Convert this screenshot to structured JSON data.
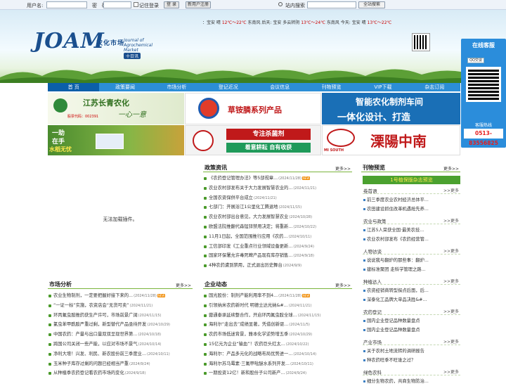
{
  "login": {
    "user_label": "用户名:",
    "pass_label": "密　码:",
    "remember_label": "记住登录",
    "login_button": "登 录",
    "register_button": "新用户注册",
    "search_label": "站内搜索",
    "search_button": "全站搜索"
  },
  "weather": {
    "prefix": "：宝安 晴",
    "t1": "12℃～22℃",
    "seg1": "东南风 后天: 宝安 多云转阴",
    "t2": "13℃～24℃",
    "seg2": "东南风 今天: 宝安 晴",
    "t3": "13℃～22℃"
  },
  "brand": {
    "logo": "JOAM",
    "name_cn": "农化市场",
    "name_en": "Journal of Agrochemical Market",
    "tag": "十日讯"
  },
  "nav": [
    "首 页",
    "政策要闻",
    "市场分析",
    "登记近况",
    "会议信息",
    "刊物预览",
    "VIP下载",
    "杂志订阅"
  ],
  "banners": {
    "b1_title": "江苏长青农化",
    "b1_sub": "股票代码：002391",
    "b1_slogan": "一心一意",
    "b2_text": "草铵膦系列产品",
    "b3_line1": "智能农化制剂车间",
    "b3_line2": "一体化设计、打造",
    "b4_line1": "一助",
    "b4_line2": "在手",
    "b4_line3": "水稻无忧",
    "b5_line1": "专注杀菌剂",
    "b5_line2": "着意耕耘 自有收获",
    "b6_brand": "MI SOUTH",
    "b6_text": "溧陽中南"
  },
  "noplug": "无法加载插件。",
  "policy": {
    "title": "政策资讯",
    "more": "更多>>",
    "items": [
      {
        "t": "《农药登记管理办法》等5部规章...",
        "d": "(2024/11/28)",
        "new": true
      },
      {
        "t": "农业农村部发布关于大力发展智慧农业的...",
        "d": "(2024/11/21)",
        "new": false
      },
      {
        "t": "全国农资保供平台成立",
        "d": "(2024/11/21)",
        "new": false
      },
      {
        "t": "七部门：开展浴江1公里化工腾退地",
        "d": "(2024/11/15)",
        "new": false
      },
      {
        "t": "农业农村部出台意见，大力发展智慧农业",
        "d": "(2024/10/28)",
        "new": false
      },
      {
        "t": "欧盟法院推翻代森锰锌禁用决定；将重新...",
        "d": "(2024/10/22)",
        "new": false
      },
      {
        "t": "11月1日起，全国范围推行应用《农药...",
        "d": "(2024/10/11)",
        "new": false
      },
      {
        "t": "工信部印发《工业重点行业领域设备更新...",
        "d": "(2024/9/24)",
        "new": false
      },
      {
        "t": "国家环保署允许毒死蜱产品现有库存销售...",
        "d": "(2024/9/18)",
        "new": false
      },
      {
        "t": "4种农药遭到禁用，正式退出历史舞台",
        "d": "(2024/9/9)",
        "new": false
      }
    ]
  },
  "market": {
    "title": "市场分析",
    "more": "更多>>",
    "items": [
      {
        "t": "农业生物制剂，一定要把握好接下来的...",
        "d": "(2024/11/28)",
        "new": true
      },
      {
        "t": "“一证一标”实施，农资店会“无货可卖”",
        "d": "(2024/11/21)",
        "new": false
      },
      {
        "t": "环丙氟虫胺推药获生产许可，市场前景广阔",
        "d": "(2024/11/15)",
        "new": false
      },
      {
        "t": "氯虫苯甲酰胺严重过剩，新型替代产品亟待开发",
        "d": "(2024/10/29)",
        "new": false
      },
      {
        "t": "中国农药：产量与出口量双双呈现世界第...",
        "d": "(2024/10/18)",
        "new": false
      },
      {
        "t": "跨国公司关闭一些产能，以应对市场不景气",
        "d": "(2024/10/14)",
        "new": false
      },
      {
        "t": "净利大增！兴发、利民、新农股份前三季度业...",
        "d": "(2024/10/11)",
        "new": false
      },
      {
        "t": "玉米种子库存过剩的问题已经相当严重",
        "d": "(2024/9/24)",
        "new": false
      },
      {
        "t": "从种植季农药登记看农药市场的变化",
        "d": "(2024/9/18)",
        "new": false
      }
    ]
  },
  "enterprise": {
    "title": "企业动态",
    "more": "更多>>",
    "items": [
      {
        "t": "国光股份：制剂产能利用率不到4...",
        "d": "(2024/11/28)",
        "new": true
      },
      {
        "t": "引领纳米农药新时代 明德立达光纳&#...",
        "d": "(2024/11/21)",
        "new": false
      },
      {
        "t": "蓉通泰承延续整合作，开启环丙氟虫胺全球...",
        "d": "(2024/11/15)",
        "new": false
      },
      {
        "t": "海利尔“走出去”成绩显著，凭借创新驱...",
        "d": "(2024/11/5)",
        "new": false
      },
      {
        "t": "农药市场低迷背景，雅本化学逆势增五季",
        "d": "(2024/10/29)",
        "new": false
      },
      {
        "t": "15亿元为企业“输血”！农药巨头红太...",
        "d": "(2024/10/22)",
        "new": false
      },
      {
        "t": "海利尔：产品多元化的战略布局优势进一...",
        "d": "(2024/10/14)",
        "new": false
      },
      {
        "t": "海利尔苏马霉素·三氟甲吡醚水系列开发...",
        "d": "(2024/10/11)",
        "new": false
      },
      {
        "t": "一期投资12亿！新和股份子公司新产...",
        "d": "(2024/9/24)",
        "new": false
      }
    ]
  },
  "preview": {
    "title": "刊物预览",
    "more": "更多>>",
    "mag_title": "1号植保版杂志预览",
    "sections": [
      {
        "t": "卷首语",
        "m": ">>更多",
        "items": [
          "前三季度农业农村经济总体平...",
          "农田建设抓住改革机遇抢先养..."
        ]
      },
      {
        "t": "农业与政策",
        "m": ">>更多",
        "items": [
          "江苏5人荣获全国·最美农技...",
          "农业农村部发布《农药经营管..."
        ]
      },
      {
        "t": "人物访谈",
        "m": ">>更多",
        "items": [
          "说说我与翻炉的那些事：翻炉...",
          "建标准聚团 走科学管理之路..."
        ]
      },
      {
        "t": "种植达人",
        "m": ">>更多",
        "items": [
          "农资经销商转型探点后面，后...",
          "深泰化工品牌大单品决胜&#..."
        ]
      },
      {
        "t": "农药登记",
        "m": ">>更多",
        "items": [
          "国内企业登记品种数量盘点",
          "国内企业登记品种数量盘点"
        ]
      },
      {
        "t": "产业市场",
        "m": ">>更多",
        "items": [
          "关于农村土地流转的调研报告",
          "种农药旺季不旺谁之过？"
        ]
      },
      {
        "t": "绿色农科",
        "m": ">>更多",
        "items": [
          "细分生物农药，共商生物防治..."
        ]
      }
    ]
  },
  "float": {
    "title": "在线客服",
    "qq": "QQ交谈",
    "hotline_label": "客服热线",
    "phone": "0513-83556825"
  }
}
